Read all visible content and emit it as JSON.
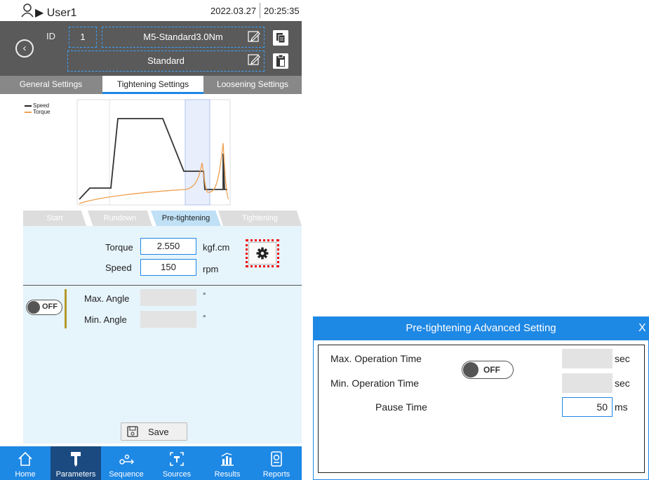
{
  "topbar": {
    "user": "User1",
    "date": "2022.03.27",
    "time": "20:25:35"
  },
  "header": {
    "id_label": "ID",
    "id_value": "1",
    "name": "M5-Standard3.0Nm",
    "description": "Standard"
  },
  "tabs": [
    "General Settings",
    "Tightening Settings",
    "Loosening Settings"
  ],
  "legend": {
    "speed": "Speed",
    "torque": "Torque",
    "speed_color": "#222222",
    "torque_color": "#f0a050"
  },
  "steps": [
    "Start",
    "Rundown",
    "Pre-tightening",
    "Tightening"
  ],
  "params": {
    "torque_label": "Torque",
    "torque_value": "2.550",
    "torque_unit": "kgf.cm",
    "speed_label": "Speed",
    "speed_value": "150",
    "speed_unit": "rpm",
    "angle_toggle": "OFF",
    "max_angle_label": "Max. Angle",
    "max_angle_unit": "°",
    "min_angle_label": "Min. Angle",
    "min_angle_unit": "°"
  },
  "save_label": "Save",
  "nav": [
    "Home",
    "Parameters",
    "Sequence",
    "Sources",
    "Results",
    "Reports"
  ],
  "dialog": {
    "title": "Pre-tightening Advanced Setting",
    "close": "X",
    "max_op_label": "Max. Operation Time",
    "min_op_label": "Min. Operation Time",
    "pause_label": "Pause Time",
    "toggle": "OFF",
    "max_op_unit": "sec",
    "min_op_unit": "sec",
    "pause_value": "50",
    "pause_unit": "ms"
  },
  "colors": {
    "accent": "#1e88e5",
    "header": "#5a5a5a",
    "panel": "#e6f4fc",
    "highlight": "#e00000"
  }
}
